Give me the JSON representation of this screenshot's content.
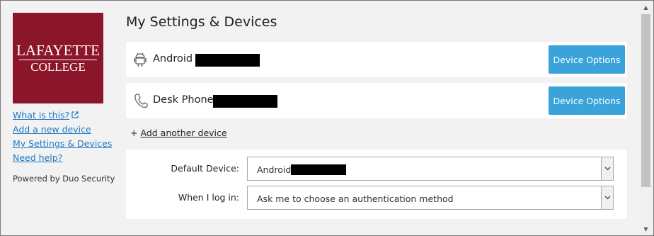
{
  "logo": {
    "line1": "LAFAYETTE",
    "line2": "COLLEGE",
    "color": "#8c1629"
  },
  "sidebar": {
    "links": [
      {
        "label": "What is this?",
        "icon": "external-link-icon"
      },
      {
        "label": "Add a new device"
      },
      {
        "label": "My Settings & Devices"
      },
      {
        "label": "Need help?"
      }
    ],
    "powered_by": "Powered by Duo Security"
  },
  "main": {
    "title": "My Settings & Devices",
    "devices": [
      {
        "name": "Android",
        "icon": "android-icon",
        "button": "Device Options"
      },
      {
        "name": "Desk Phone",
        "icon": "phone-icon",
        "button": "Device Options"
      }
    ],
    "add_another": {
      "prefix": "+",
      "label": "Add another device"
    },
    "settings": {
      "default_device_label": "Default Device:",
      "default_device_value": "Android",
      "login_label": "When I log in:",
      "login_value": "Ask me to choose an authentication method"
    }
  },
  "colors": {
    "accent": "#3aa3d9",
    "link": "#1f78c1",
    "background": "#f2f2f2"
  }
}
